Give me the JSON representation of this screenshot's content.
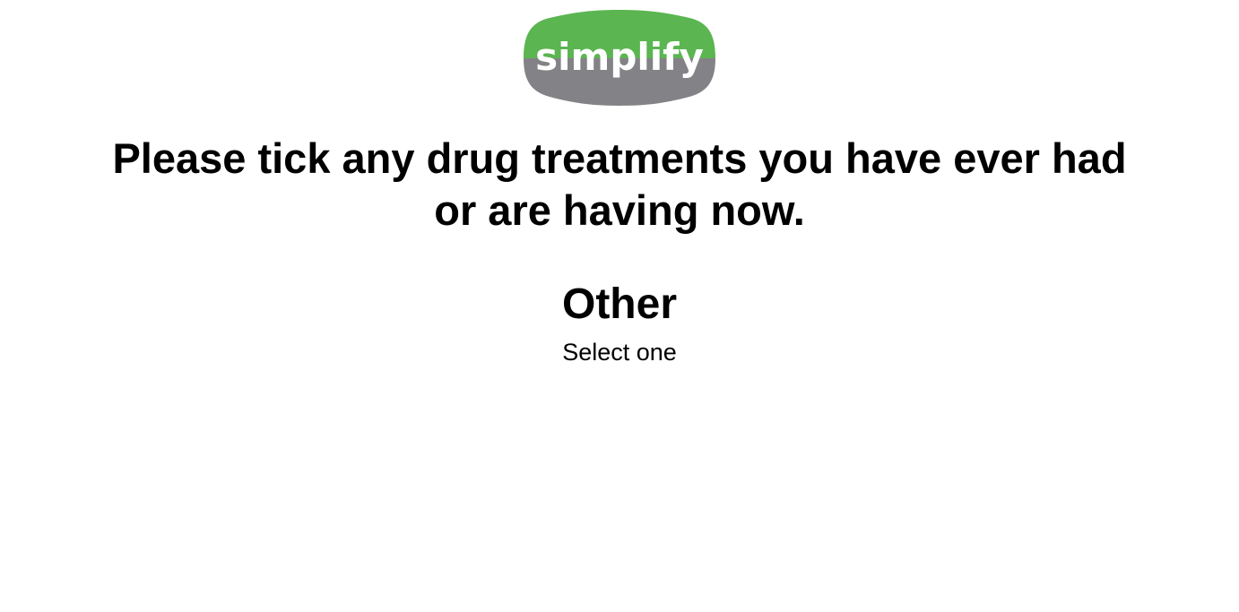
{
  "brand": {
    "logo_text": "simplify",
    "colors": {
      "green": "#5bb551",
      "gray": "#838387",
      "logo_text": "#ffffff"
    }
  },
  "question": {
    "line1": "Please tick any drug treatments you have ever had",
    "line2": "or are having now."
  },
  "section": {
    "title": "Other",
    "hint": "Select one"
  }
}
